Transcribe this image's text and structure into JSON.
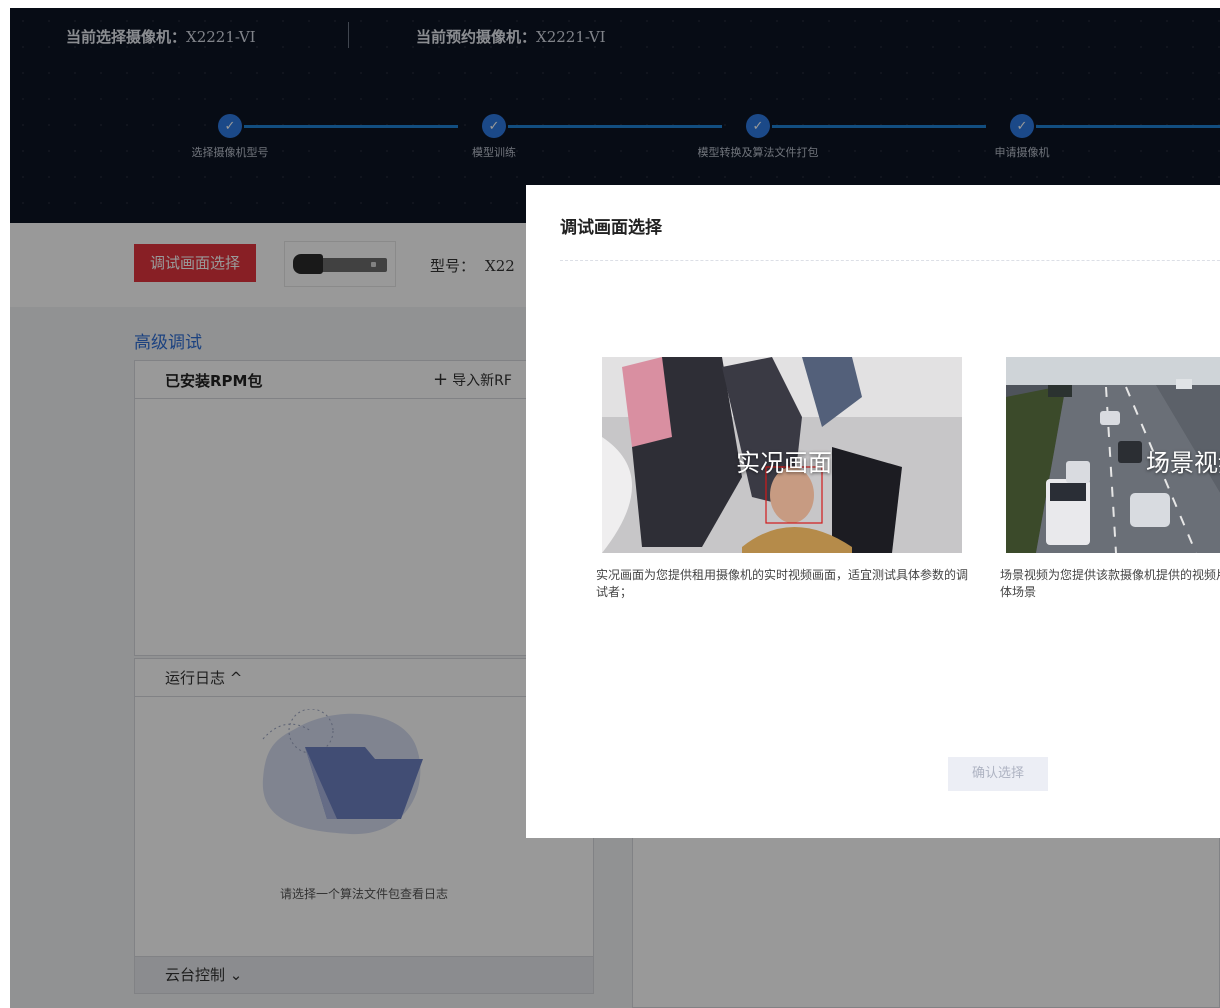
{
  "header": {
    "current_camera_label": "当前选择摄像机：",
    "current_camera_value": "X2221-VI",
    "reserved_camera_label": "当前预约摄像机：",
    "reserved_camera_value": "X2221-VI",
    "steps": [
      {
        "label": "选择摄像机型号",
        "icon": "check-icon",
        "status": "done"
      },
      {
        "label": "模型训练",
        "icon": "check-icon",
        "status": "done"
      },
      {
        "label": "模型转换及算法文件打包",
        "icon": "check-icon",
        "status": "done"
      },
      {
        "label": "申请摄像机",
        "icon": "check-icon",
        "status": "done"
      }
    ]
  },
  "toolbar": {
    "debug_tab_label": "调试画面选择",
    "model_label": "型号：",
    "model_value": "X22"
  },
  "advanced": {
    "title": "高级调试",
    "rpm_title": "已安装RPM包",
    "import_label": "导入新RF",
    "import_icon": "plus-icon"
  },
  "log": {
    "title": "运行日志 ^",
    "empty_text": "请选择一个算法文件包查看日志"
  },
  "ptz": {
    "title": "云台控制 ⌄"
  },
  "modal": {
    "title": "调试画面选择",
    "options": [
      {
        "overlay": "实况画面",
        "description": "实况画面为您提供租用摄像机的实时视频画面，适宜测试具体参数的调试者；"
      },
      {
        "overlay": "场景视频",
        "description": "场景视频为您提供该款摄像机提供的视频片段，适宜调试摄像机在各具体场景"
      }
    ],
    "confirm_label": "确认选择"
  },
  "colors": {
    "header_bg": "#0c1424",
    "step_blue": "#2e7be3",
    "accent_red": "#e3343e",
    "link_blue": "#2f6fd6"
  }
}
